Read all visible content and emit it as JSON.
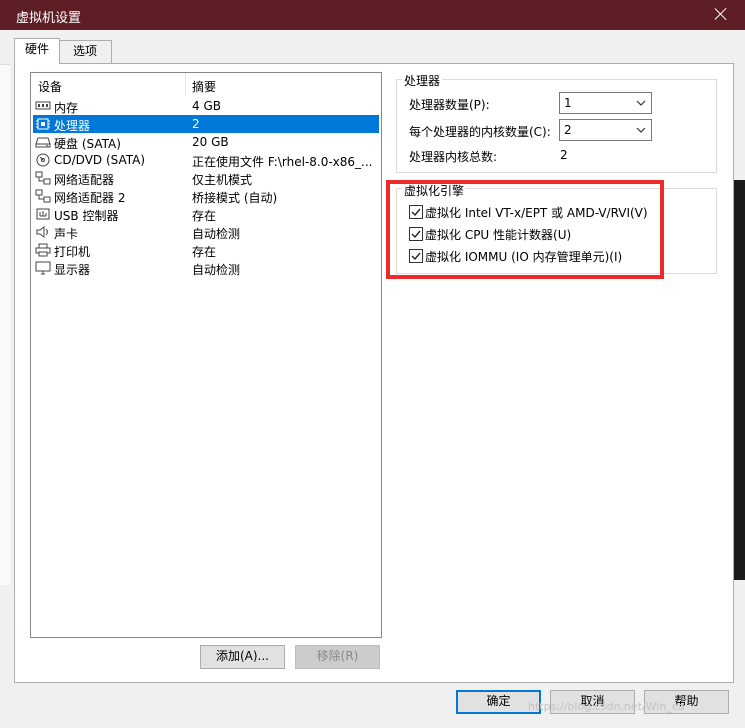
{
  "window": {
    "title": "虚拟机设置"
  },
  "tabs": [
    {
      "label": "硬件"
    },
    {
      "label": "选项"
    }
  ],
  "device_list": {
    "col_device": "设备",
    "col_summary": "摘要",
    "rows": [
      {
        "icon": "memory-icon",
        "name": "内存",
        "summary": "4 GB"
      },
      {
        "icon": "cpu-icon",
        "name": "处理器",
        "summary": "2"
      },
      {
        "icon": "harddisk-icon",
        "name": "硬盘 (SATA)",
        "summary": "20 GB"
      },
      {
        "icon": "cdrom-icon",
        "name": "CD/DVD (SATA)",
        "summary": "正在使用文件 F:\\rhel-8.0-x86_..."
      },
      {
        "icon": "network-icon",
        "name": "网络适配器",
        "summary": "仅主机模式"
      },
      {
        "icon": "network-icon",
        "name": "网络适配器 2",
        "summary": "桥接模式 (自动)"
      },
      {
        "icon": "usb-icon",
        "name": "USB 控制器",
        "summary": "存在"
      },
      {
        "icon": "sound-icon",
        "name": "声卡",
        "summary": "自动检测"
      },
      {
        "icon": "printer-icon",
        "name": "打印机",
        "summary": "存在"
      },
      {
        "icon": "display-icon",
        "name": "显示器",
        "summary": "自动检测"
      }
    ]
  },
  "device_buttons": {
    "add": "添加(A)...",
    "remove": "移除(R)"
  },
  "processor": {
    "group_title": "处理器",
    "count_label": "处理器数量(P):",
    "count_value": "1",
    "cores_label": "每个处理器的内核数量(C):",
    "cores_value": "2",
    "total_label": "处理器内核总数:",
    "total_value": "2"
  },
  "virtualization": {
    "group_title": "虚拟化引擎",
    "options": [
      {
        "label": "虚拟化 Intel VT-x/EPT 或 AMD-V/RVI(V)",
        "checked": true
      },
      {
        "label": "虚拟化 CPU 性能计数器(U)",
        "checked": true
      },
      {
        "label": "虚拟化 IOMMU (IO 内存管理单元)(I)",
        "checked": true
      }
    ]
  },
  "footer": {
    "ok": "确定",
    "cancel": "取消",
    "help": "帮助"
  },
  "watermark": "https://blog.csdn.net/Win_ca",
  "colors": {
    "titlebar": "#5e1e26",
    "selection": "#0078d7",
    "highlight": "#ee2a2a"
  }
}
